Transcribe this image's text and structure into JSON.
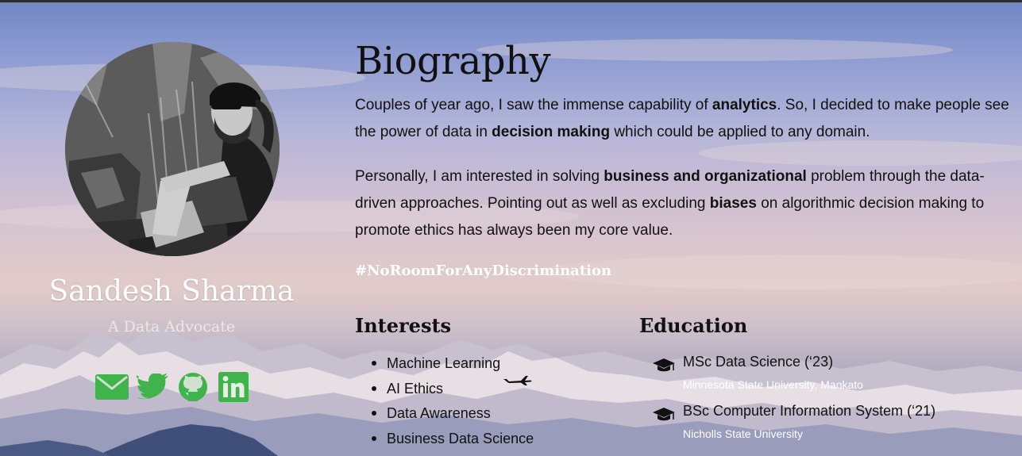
{
  "profile": {
    "name": "Sandesh Sharma",
    "tagline": "A Data Advocate",
    "socials": [
      {
        "icon": "envelope-icon",
        "label": "Email"
      },
      {
        "icon": "twitter-icon",
        "label": "Twitter"
      },
      {
        "icon": "github-icon",
        "label": "GitHub"
      },
      {
        "icon": "linkedin-icon",
        "label": "LinkedIn"
      }
    ],
    "social_color": "#3fb44a"
  },
  "biography": {
    "title": "Biography",
    "p1": {
      "t1": "Couples of year ago, I saw the immense capability of ",
      "b1": "analytics",
      "t2": ". So, I decided to make people see the power of data in ",
      "b2": "decision making",
      "t3": " which could be applied to any domain."
    },
    "p2": {
      "t1": "Personally, I am interested in solving ",
      "b1": "business and organizational",
      "t2": " problem through the data-driven approaches. Pointing out as well as excluding ",
      "b2": "biases",
      "t3": " on algorithmic decision making to promote ethics has always been my core value."
    },
    "hashtag": "#NoRoomForAnyDiscrimination"
  },
  "interests": {
    "title": "Interests",
    "items": [
      "Machine Learning",
      "AI Ethics",
      "Data Awareness",
      "Business Data Science"
    ]
  },
  "education": {
    "title": "Education",
    "items": [
      {
        "degree": "MSc Data Science (‘23)",
        "school": "Minnesota State University, Mankato"
      },
      {
        "degree": "BSc Computer Information System (‘21)",
        "school": "Nicholls State University"
      }
    ]
  }
}
